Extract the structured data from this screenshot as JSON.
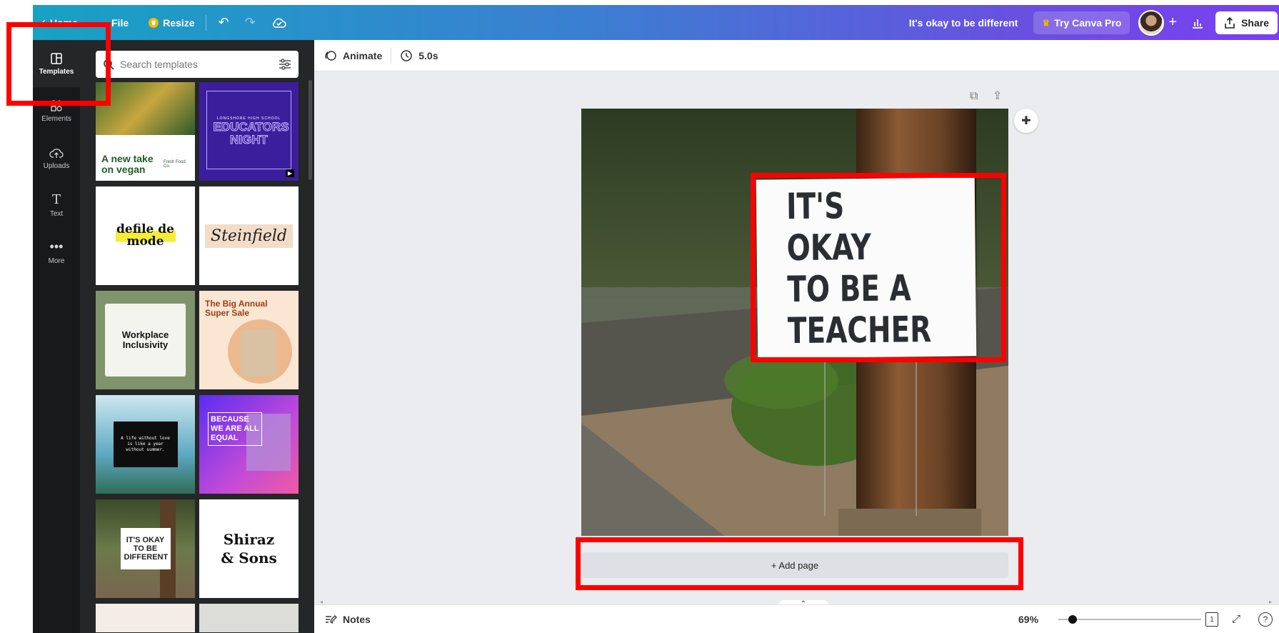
{
  "topbar": {
    "home_label": "Home",
    "file_label": "File",
    "resize_label": "Resize",
    "design_title": "It's okay to be different",
    "pro_label": "Try Canva Pro",
    "share_label": "Share"
  },
  "rail": {
    "items": [
      {
        "label": "Templates",
        "icon": "templates-icon"
      },
      {
        "label": "Elements",
        "icon": "elements-icon"
      },
      {
        "label": "Uploads",
        "icon": "uploads-icon"
      },
      {
        "label": "Text",
        "icon": "text-icon"
      },
      {
        "label": "More",
        "icon": "more-icon"
      }
    ]
  },
  "panel": {
    "search_placeholder": "Search templates",
    "templates": [
      {
        "text": "A new take on vegan",
        "sub": "Fresh Food Co."
      },
      {
        "text": "EDUCATORS NIGHT",
        "sub": "LONGSHORE HIGH SCHOOL"
      },
      {
        "text": "defile de mode",
        "sub": ""
      },
      {
        "text": "Steinfield",
        "sub": ""
      },
      {
        "text": "Workplace Inclusivity",
        "sub": ""
      },
      {
        "text": "The Big Annual Super Sale",
        "sub": ""
      },
      {
        "text": "A life without love is like a year without summer.",
        "sub": ""
      },
      {
        "text": "BECAUSE WE ARE ALL EQUAL",
        "sub": ""
      },
      {
        "text": "IT'S OKAY TO BE DIFFERENT",
        "sub": ""
      },
      {
        "text": "Shiraz & Sons",
        "sub": ""
      }
    ]
  },
  "subbar": {
    "animate_label": "Animate",
    "duration_label": "5.0s"
  },
  "canvas": {
    "sign_line1": "IT'S OKAY",
    "sign_line2": "TO BE A",
    "sign_line3": "TEACHER",
    "add_page_label": "+ Add page"
  },
  "bottom": {
    "notes_label": "Notes",
    "zoom_label": "69%",
    "page_count": "1"
  },
  "colors": {
    "highlight": "#ff0000",
    "rail_bg": "#18191b",
    "panel_bg": "#252627"
  }
}
